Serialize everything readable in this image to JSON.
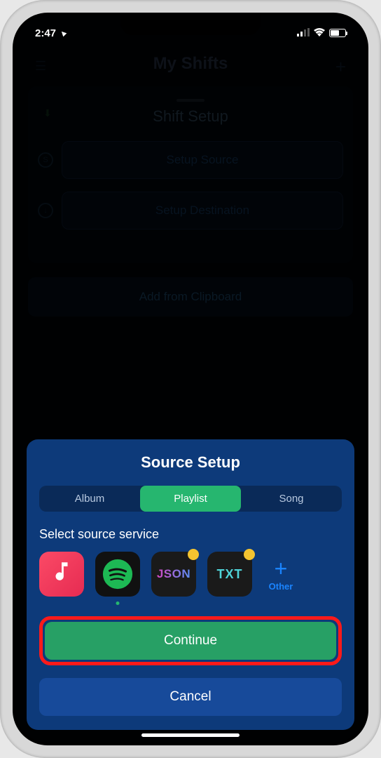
{
  "status": {
    "time": "2:47",
    "location_arrow": "➤"
  },
  "bg": {
    "app_title": "My Shifts",
    "card_title": "Shift Setup",
    "source_btn": "Setup Source",
    "dest_btn": "Setup Destination",
    "clipboard_btn": "Add from Clipboard"
  },
  "sheet": {
    "title": "Source Setup",
    "segments": [
      "Album",
      "Playlist",
      "Song"
    ],
    "active_segment_index": 1,
    "section_label": "Select source service",
    "services": {
      "apple_music": "Apple Music",
      "spotify": "Spotify",
      "json": "JSON",
      "txt": "TXT",
      "other": "Other"
    },
    "selected_service_index": 1,
    "continue_label": "Continue",
    "cancel_label": "Cancel"
  },
  "colors": {
    "sheet_bg": "#0d3a7a",
    "accent_green": "#26b66f",
    "highlight_red": "#ff1a1a",
    "link_blue": "#1a84ff"
  }
}
